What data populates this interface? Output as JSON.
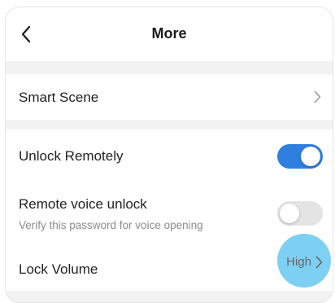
{
  "header": {
    "title": "More",
    "back_icon": "chevron-left-icon"
  },
  "settings": {
    "smart_scene": {
      "label": "Smart Scene",
      "icon": "chevron-right-icon"
    },
    "unlock_remotely": {
      "label": "Unlock Remotely",
      "enabled": true
    },
    "remote_voice_unlock": {
      "label": "Remote voice unlock",
      "description": "Verify this password for voice opening",
      "enabled": false
    },
    "lock_volume": {
      "label": "Lock Volume",
      "value": "High",
      "icon": "chevron-right-icon"
    }
  },
  "colors": {
    "toggle_on": "#2e7fe0",
    "toggle_off": "#e4e4e4",
    "background": "#f2f2f2",
    "touch_indicator": "#66c8f0"
  }
}
